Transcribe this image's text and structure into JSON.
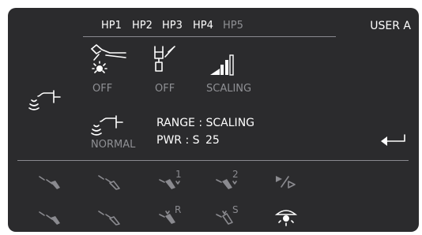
{
  "header": {
    "handpieces": [
      {
        "label": "HP1",
        "active": true
      },
      {
        "label": "HP2",
        "active": true
      },
      {
        "label": "HP3",
        "active": true
      },
      {
        "label": "HP4",
        "active": true
      },
      {
        "label": "HP5",
        "active": false
      }
    ],
    "user": "USER A"
  },
  "controls": {
    "light_status": "OFF",
    "water_status": "OFF",
    "mode": "SCALING",
    "scaler_mode": "NORMAL"
  },
  "info": {
    "range_label": "RANGE : SCALING",
    "power_label": "PWR : S",
    "power_value": "25"
  },
  "bottom_icons": {
    "row1": [
      "handpiece-1-icon",
      "handpiece-2-icon",
      "handpiece-3-icon",
      "handpiece-4-icon",
      "next-page-icon"
    ],
    "row1_marks": [
      "1",
      "2"
    ],
    "row2": [
      "handpiece-5-icon",
      "handpiece-6-icon",
      "handpiece-r-icon",
      "handpiece-s-icon",
      "operating-light-icon"
    ],
    "row2_marks": [
      "R",
      "S"
    ]
  },
  "colors": {
    "panel": "#2b2b2d",
    "active_text": "#ffffff",
    "inactive_text": "#8f9094"
  }
}
